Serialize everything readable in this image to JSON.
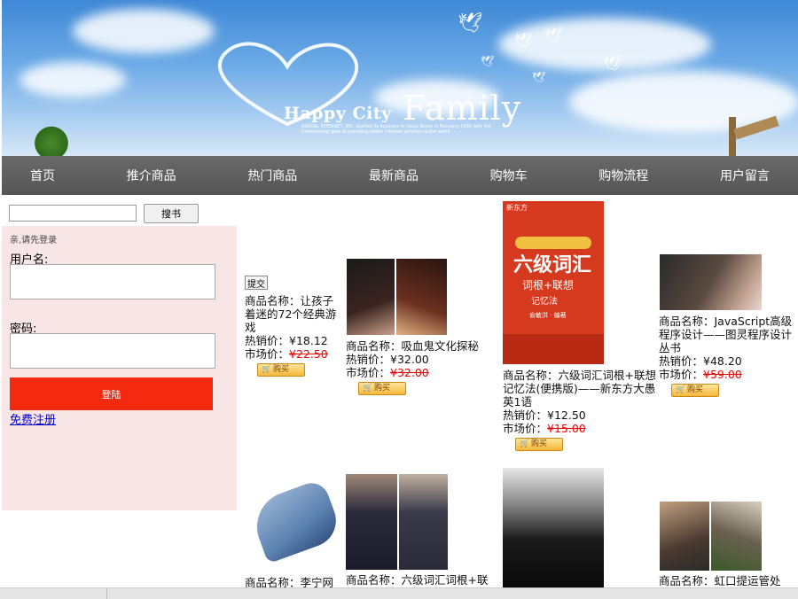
{
  "banner": {
    "brand_small": "Happy City",
    "brand_big": "Family",
    "tagline": "ASADAL INTERNET, INC. started its business in Seoul Korea in February 1998 with the fundamental goal of providing better internet services to the world"
  },
  "nav": [
    "首页",
    "推介商品",
    "热门商品",
    "最新商品",
    "购物车",
    "购物流程",
    "用户留言"
  ],
  "search": {
    "value": "",
    "button": "搜书"
  },
  "login": {
    "hint": "亲,请先登录",
    "username_label": "用户名:",
    "password_label": "密码:",
    "login_button": "登陆",
    "register_link": "免费注册"
  },
  "submit_button": "提交",
  "buy_label": "购买",
  "products": [
    {
      "name": "商品名称：让孩子着迷的72个经典游戏",
      "hot": "热销价：¥18.12",
      "market_label": "市场价：",
      "market": "¥22.50"
    },
    {
      "name": "商品名称：吸血鬼文化探秘",
      "hot": "热销价：¥32.00",
      "market_label": "市场价：",
      "market": "¥32.00"
    },
    {
      "name": "商品名称：六级词汇词根+联想记忆法(便携版)——新东方大愚英1语",
      "hot": "热销价：¥12.50",
      "market_label": "市场价：",
      "market": "¥15.00"
    },
    {
      "name": "商品名称：JavaScript高级程序设计——图灵程序设计丛书",
      "hot": "热销价：¥48.20",
      "market_label": "市场价：",
      "market": "¥59.00"
    },
    {
      "name": "商品名称：李宁网"
    },
    {
      "name": "商品名称：六级词汇词根+联"
    },
    {
      "name": ""
    },
    {
      "name": "商品名称：虹口提运管处"
    }
  ],
  "book_cover": {
    "publisher": "新东方",
    "title": "六级词汇",
    "subtitle": "词根+联想",
    "sub2": "记忆法",
    "author": "俞敏洪 · 编著"
  },
  "colors": {
    "nav": "#5c5c5c",
    "login_bg": "#f8e6e6",
    "login_button": "#f32a10",
    "strike_price": "#ee0000"
  }
}
